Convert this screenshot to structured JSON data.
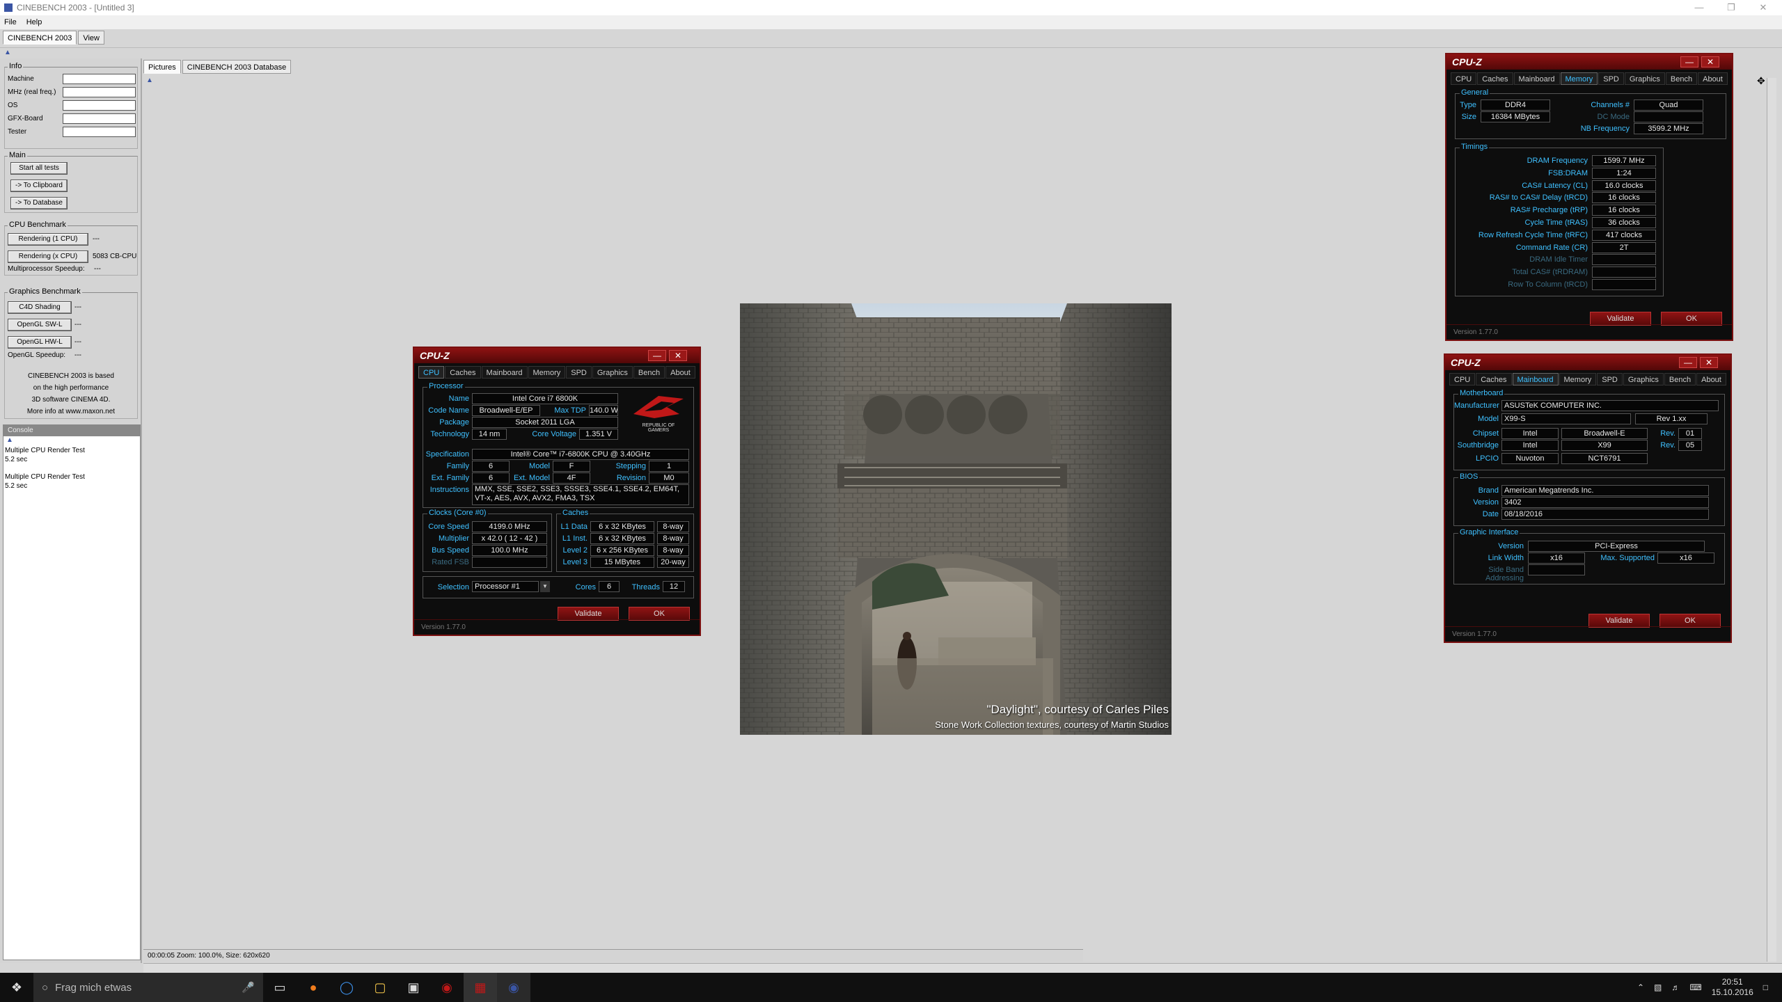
{
  "window": {
    "title": "CINEBENCH 2003 - [Untitled 3]"
  },
  "menu": {
    "file": "File",
    "help": "Help"
  },
  "apptabs": {
    "cinebench": "CINEBENCH 2003",
    "view": "View"
  },
  "info": {
    "title": "Info",
    "machine": "Machine",
    "mhz": "MHz (real freq.)",
    "os": "OS",
    "gfx": "GFX-Board",
    "tester": "Tester"
  },
  "main": {
    "title": "Main",
    "start": "Start all tests",
    "clipboard": "-> To Clipboard",
    "database": "-> To Database"
  },
  "cpubench": {
    "title": "CPU Benchmark",
    "r1": "Rendering (1 CPU)",
    "r1_val": "---",
    "rx": "Rendering (x CPU)",
    "rx_val": "5083 CB-CPU",
    "mp": "Multiprocessor Speedup:",
    "mp_val": "---"
  },
  "gfxbench": {
    "title": "Graphics Benchmark",
    "c4d": "C4D Shading",
    "c4d_val": "---",
    "swl": "OpenGL SW-L",
    "swl_val": "---",
    "hwl": "OpenGL HW-L",
    "hwl_val": "---",
    "speedup": "OpenGL Speedup:",
    "speedup_val": "---"
  },
  "about": {
    "l1": "CINEBENCH 2003 is based",
    "l2": "on the high performance",
    "l3": "3D software CINEMA 4D.",
    "l4": "More info at www.maxon.net"
  },
  "console": {
    "title": "Console",
    "line1": "Multiple CPU Render Test",
    "line2": "5.2 sec",
    "line3": "Multiple CPU Render Test",
    "line4": "5.2 sec"
  },
  "doctabs": {
    "pictures": "Pictures",
    "database": "CINEBENCH 2003 Database"
  },
  "status": {
    "text": "00:00:05  Zoom: 100.0%, Size: 620x620"
  },
  "render": {
    "credit1": "\"Daylight\", courtesy of Carles Piles",
    "credit2": "Stone Work Collection textures, courtesy of Martin Studios"
  },
  "taskbar": {
    "search": "Frag mich etwas",
    "time": "20:51",
    "date": "15.10.2016"
  },
  "cpuz_common": {
    "title": "CPU-Z",
    "version": "Version 1.77.0",
    "validate": "Validate",
    "ok": "OK",
    "tabs": [
      "CPU",
      "Caches",
      "Mainboard",
      "Memory",
      "SPD",
      "Graphics",
      "Bench",
      "About"
    ]
  },
  "cpu": {
    "f_proc": "Processor",
    "name_k": "Name",
    "name": "Intel Core i7 6800K",
    "code_k": "Code Name",
    "code": "Broadwell-E/EP",
    "tdp_k": "Max TDP",
    "tdp": "140.0 W",
    "pkg_k": "Package",
    "pkg": "Socket 2011 LGA",
    "tech_k": "Technology",
    "tech": "14 nm",
    "volt_k": "Core Voltage",
    "volt": "1.351 V",
    "spec_k": "Specification",
    "spec": "Intel® Core™ i7-6800K CPU @ 3.40GHz",
    "fam_k": "Family",
    "fam": "6",
    "model_k": "Model",
    "model": "F",
    "step_k": "Stepping",
    "step": "1",
    "efam_k": "Ext. Family",
    "efam": "6",
    "emod_k": "Ext. Model",
    "emod": "4F",
    "rev_k": "Revision",
    "rev": "M0",
    "ins_k": "Instructions",
    "ins": "MMX, SSE, SSE2, SSE3, SSSE3, SSE4.1, SSE4.2, EM64T, VT-x, AES, AVX, AVX2, FMA3, TSX",
    "f_clocks": "Clocks (Core #0)",
    "cs_k": "Core Speed",
    "cs": "4199.0 MHz",
    "mul_k": "Multiplier",
    "mul": "x 42.0 ( 12 - 42 )",
    "bus_k": "Bus Speed",
    "bus": "100.0 MHz",
    "fsb_k": "Rated FSB",
    "fsb": "",
    "f_caches": "Caches",
    "l1d_k": "L1 Data",
    "l1d": "6 x 32 KBytes",
    "l1d_w": "8-way",
    "l1i_k": "L1 Inst.",
    "l1i": "6 x 32 KBytes",
    "l1i_w": "8-way",
    "l2_k": "Level 2",
    "l2": "6 x 256 KBytes",
    "l2_w": "8-way",
    "l3_k": "Level 3",
    "l3": "15 MBytes",
    "l3_w": "20-way",
    "sel_k": "Selection",
    "sel": "Processor #1",
    "cores_k": "Cores",
    "cores": "6",
    "thr_k": "Threads",
    "thr": "12",
    "logo1": "REPUBLIC OF",
    "logo2": "GAMERS"
  },
  "memory": {
    "f_gen": "General",
    "type_k": "Type",
    "type": "DDR4",
    "ch_k": "Channels #",
    "ch": "Quad",
    "size_k": "Size",
    "size": "16384 MBytes",
    "dc_k": "DC Mode",
    "dc": "",
    "nb_k": "NB Frequency",
    "nb": "3599.2 MHz",
    "f_tim": "Timings",
    "rows": [
      {
        "k": "DRAM Frequency",
        "v": "1599.7 MHz"
      },
      {
        "k": "FSB:DRAM",
        "v": "1:24"
      },
      {
        "k": "CAS# Latency (CL)",
        "v": "16.0 clocks"
      },
      {
        "k": "RAS# to CAS# Delay (tRCD)",
        "v": "16 clocks"
      },
      {
        "k": "RAS# Precharge (tRP)",
        "v": "16 clocks"
      },
      {
        "k": "Cycle Time (tRAS)",
        "v": "36 clocks"
      },
      {
        "k": "Row Refresh Cycle Time (tRFC)",
        "v": "417 clocks"
      },
      {
        "k": "Command Rate (CR)",
        "v": "2T"
      },
      {
        "k": "DRAM Idle Timer",
        "v": ""
      },
      {
        "k": "Total CAS# (tRDRAM)",
        "v": ""
      },
      {
        "k": "Row To Column (tRCD)",
        "v": ""
      }
    ]
  },
  "mainboard": {
    "f_mb": "Motherboard",
    "man_k": "Manufacturer",
    "man": "ASUSTeK COMPUTER INC.",
    "model_k": "Model",
    "model": "X99-S",
    "rev": "Rev 1.xx",
    "chip_k": "Chipset",
    "chip": "Intel",
    "chip2": "Broadwell-E",
    "chiprev_k": "Rev.",
    "chiprev": "01",
    "sb_k": "Southbridge",
    "sb": "Intel",
    "sb2": "X99",
    "sbrev_k": "Rev.",
    "sbrev": "05",
    "lpc_k": "LPCIO",
    "lpc": "Nuvoton",
    "lpc2": "NCT6791",
    "f_bios": "BIOS",
    "brand_k": "Brand",
    "brand": "American Megatrends Inc.",
    "ver_k": "Version",
    "ver": "3402",
    "date_k": "Date",
    "date": "08/18/2016",
    "f_gi": "Graphic Interface",
    "giv_k": "Version",
    "giv": "PCI-Express",
    "lw_k": "Link Width",
    "lw": "x16",
    "ms_k": "Max. Supported",
    "ms": "x16",
    "sba_k": "Side Band Addressing",
    "sba": ""
  }
}
